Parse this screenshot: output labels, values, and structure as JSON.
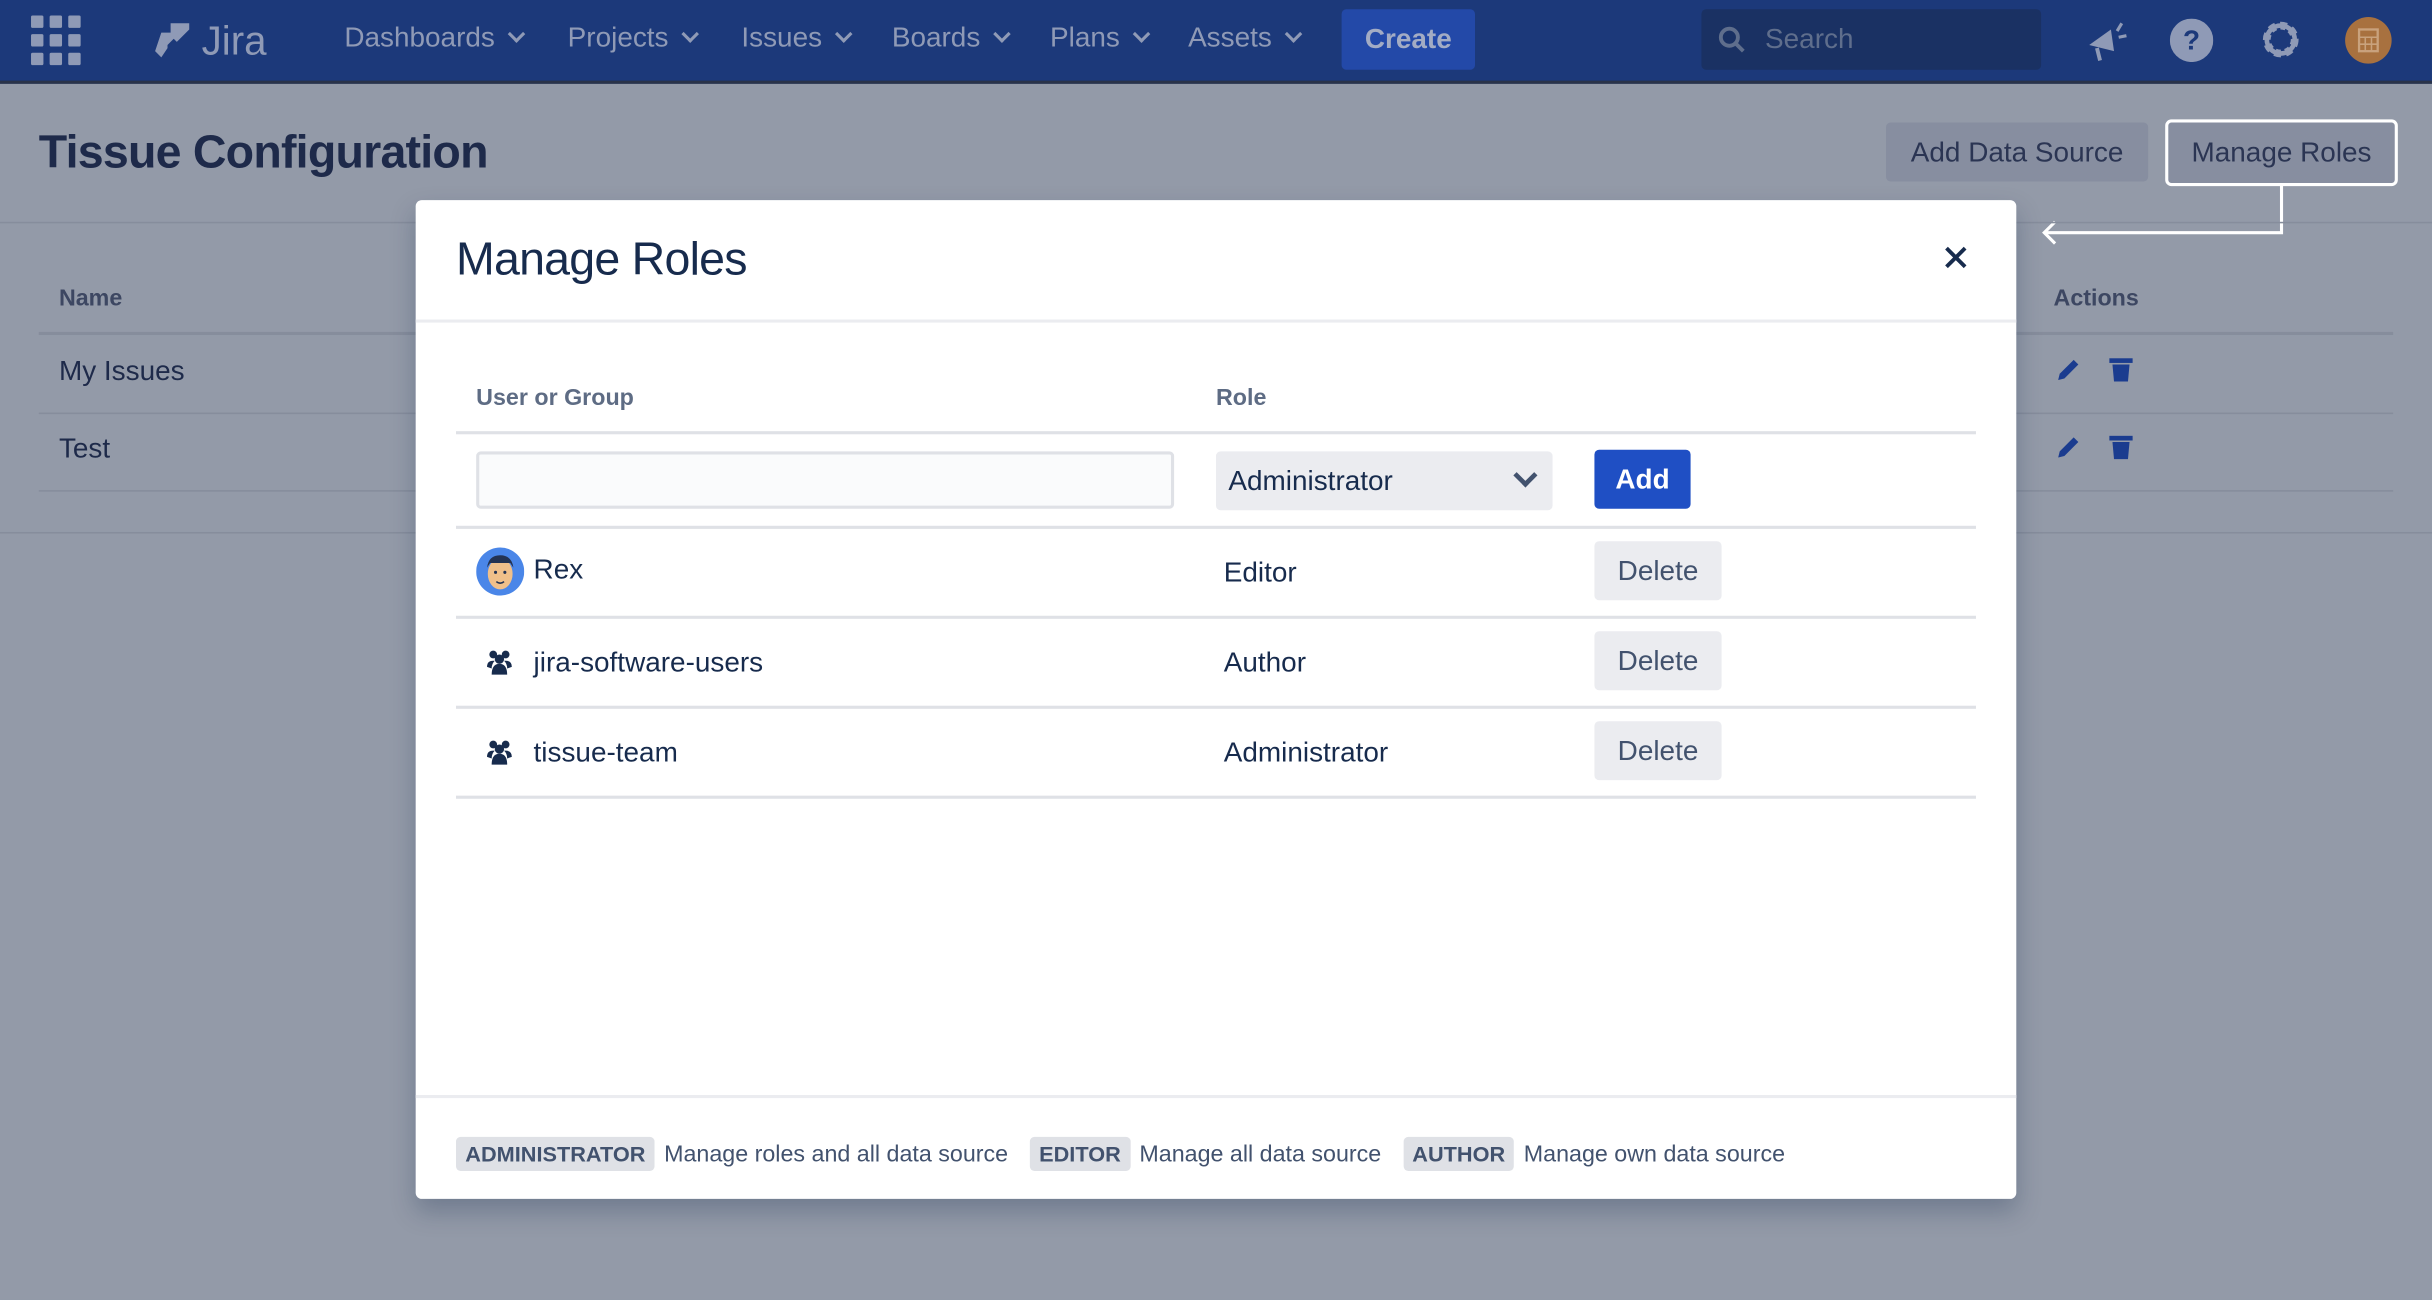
{
  "nav": {
    "logo": "Jira",
    "items": [
      "Dashboards",
      "Projects",
      "Issues",
      "Boards",
      "Plans",
      "Assets"
    ],
    "create_label": "Create",
    "search_placeholder": "Search",
    "icons": [
      "app-switcher-icon",
      "megaphone-icon",
      "help-icon",
      "gear-icon",
      "avatar"
    ]
  },
  "page": {
    "title": "Tissue Configuration",
    "add_data_source_label": "Add Data Source",
    "manage_roles_label": "Manage Roles",
    "table": {
      "headers": {
        "name": "Name",
        "actions": "Actions"
      },
      "rows": [
        {
          "name": "My Issues"
        },
        {
          "name": "Test"
        }
      ]
    }
  },
  "modal": {
    "title": "Manage Roles",
    "headers": {
      "user": "User or Group",
      "role": "Role"
    },
    "input_value": "",
    "role_select": "Administrator",
    "add_label": "Add",
    "rows": [
      {
        "name": "Rex",
        "type": "user",
        "role": "Editor",
        "action": "Delete"
      },
      {
        "name": "jira-software-users",
        "type": "group",
        "role": "Author",
        "action": "Delete"
      },
      {
        "name": "tissue-team",
        "type": "group",
        "role": "Administrator",
        "action": "Delete"
      }
    ],
    "legend": [
      {
        "badge": "ADMINISTRATOR",
        "text": "Manage roles and all data source"
      },
      {
        "badge": "EDITOR",
        "text": "Manage all data source"
      },
      {
        "badge": "AUTHOR",
        "text": "Manage own data source"
      }
    ]
  },
  "colors": {
    "nav": "#1c397a",
    "primary": "#1f4fc4",
    "overlay_bg": "#939aa8",
    "avatar": "#a8713f"
  }
}
